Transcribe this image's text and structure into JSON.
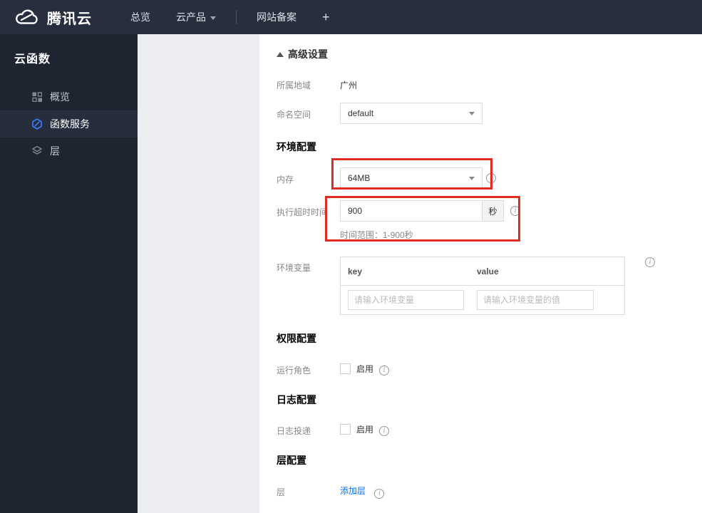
{
  "navbar": {
    "brand": "腾讯云",
    "items": [
      {
        "label": "总览"
      },
      {
        "label": "云产品"
      },
      {
        "label": "网站备案"
      }
    ],
    "plus_label": "+"
  },
  "sidebar": {
    "title": "云函数",
    "items": [
      {
        "label": "概览",
        "icon": "grid-icon",
        "selected": false
      },
      {
        "label": "函数服务",
        "icon": "function-hexagon-icon",
        "selected": true
      },
      {
        "label": "层",
        "icon": "layers-icon",
        "selected": false
      }
    ]
  },
  "form": {
    "advanced_toggle": "高级设置",
    "region": {
      "label": "所属地域",
      "value": "广州"
    },
    "namespace": {
      "label": "命名空间",
      "value": "default"
    },
    "section_env": "环境配置",
    "memory": {
      "label": "内存",
      "value": "64MB"
    },
    "timeout": {
      "label": "执行超时时间",
      "value": "900",
      "unit": "秒",
      "hint": "时间范围：1-900秒"
    },
    "env_vars": {
      "label": "环境变量",
      "key_header": "key",
      "value_header": "value",
      "key_placeholder": "请输入环境变量",
      "value_placeholder": "请输入环境变量的值"
    },
    "section_perm": "权限配置",
    "run_role": {
      "label": "运行角色",
      "checkbox_label": "启用",
      "checked": false
    },
    "section_log": "日志配置",
    "log_delivery": {
      "label": "日志投递",
      "checkbox_label": "启用",
      "checked": false
    },
    "section_layer": "层配置",
    "layer": {
      "label": "层",
      "link_label": "添加层"
    }
  },
  "colors": {
    "navbar_bg": "#272f3e",
    "sidebar_bg": "#1e2430",
    "sidebar_selected_bg": "#262e3d",
    "accent_blue": "#006eff",
    "annotation_red": "#e02d22",
    "panel_gray": "#eceef1"
  }
}
